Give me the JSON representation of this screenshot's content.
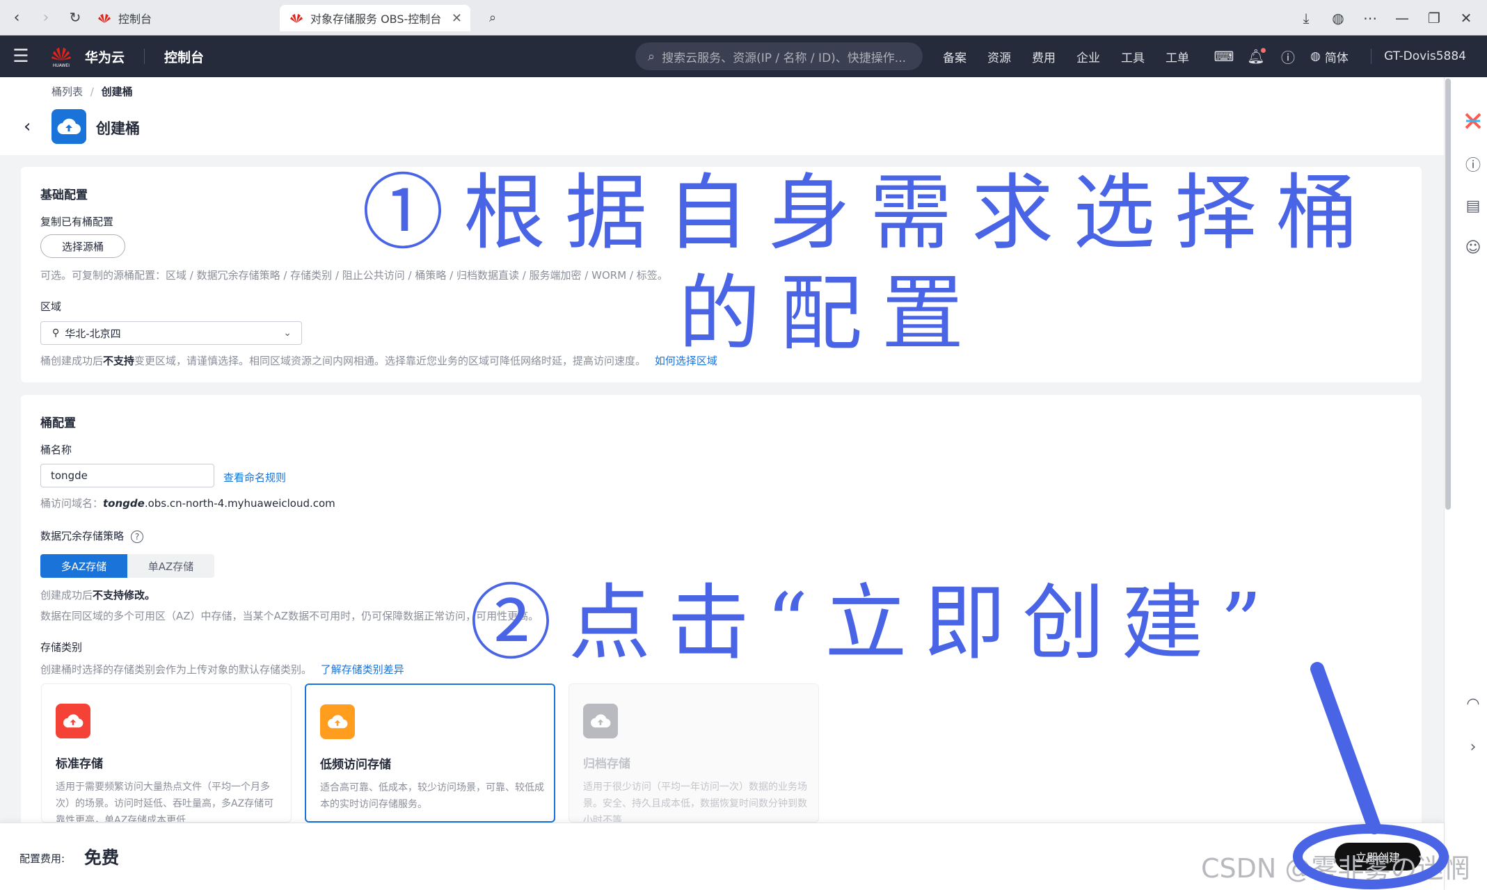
{
  "browser": {
    "tabs": [
      {
        "label": "控制台",
        "active": false
      },
      {
        "label": "对象存储服务 OBS-控制台",
        "active": true
      }
    ]
  },
  "header": {
    "brand": "华为云",
    "logo_text": "HUAWEI",
    "console": "控制台",
    "search_placeholder": "搜索云服务、资源(IP / 名称 / ID)、快捷操作...",
    "nav": [
      "备案",
      "资源",
      "费用",
      "企业",
      "工具",
      "工单"
    ],
    "lang": "简体",
    "user": "GT-Dovis5884"
  },
  "page": {
    "breadcrumb_parent": "桶列表",
    "breadcrumb_sep": "/",
    "breadcrumb_current": "创建桶",
    "title": "创建桶"
  },
  "basic": {
    "section_title": "基础配置",
    "copy_label": "复制已有桶配置",
    "select_source_btn": "选择源桶",
    "copy_hint": "可选。可复制的源桶配置：区域 / 数据冗余存储策略 / 存储类别 / 阻止公共访问 / 桶策略 / 归档数据直读 / 服务端加密 / WORM / 标签。",
    "region_label": "区域",
    "region_value": "华北-北京四",
    "region_hint_pre": "桶创建成功后",
    "region_hint_bold": "不支持",
    "region_hint_post": "变更区域，请谨慎选择。相同区域资源之间内网相通。选择靠近您业务的区域可降低网络时延，提高访问速度。",
    "region_link": "如何选择区域"
  },
  "bucket": {
    "section_title": "桶配置",
    "name_label": "桶名称",
    "name_value": "tongde",
    "naming_rule_link": "查看命名规则",
    "domain_label": "桶访问域名：",
    "domain_bucket": "tongde",
    "domain_suffix": ".obs.cn-north-4.myhuaweicloud.com",
    "redundancy_label": "数据冗余存储策略",
    "redundancy_options": [
      "多AZ存储",
      "单AZ存储"
    ],
    "redundancy_hint_pre": "创建成功后",
    "redundancy_hint_bold": "不支持修改。",
    "redundancy_desc": "数据在同区域的多个可用区（AZ）中存储，当某个AZ数据不可用时，仍可保障数据正常访问，可用性更高。",
    "storage_class_label": "存储类别",
    "storage_class_hint": "创建桶时选择的存储类别会作为上传对象的默认存储类别。",
    "storage_class_link": "了解存储类别差异",
    "storage_classes": [
      {
        "title": "标准存储",
        "desc": "适用于需要频繁访问大量热点文件（平均一个月多次）的场景。访问时延低、吞吐量高，多AZ存储可靠性更高，单AZ存储成本更低",
        "color": "#f44336"
      },
      {
        "title": "低频访问存储",
        "desc": "适合高可靠、低成本，较少访问场景，可靠、较低成本的实时访问存储服务。",
        "color": "#ff9d1f"
      },
      {
        "title": "归档存储",
        "desc": "适用于很少访问（平均一年访问一次）数据的业务场景。安全、持久且成本低，数据恢复时间数分钟到数小时不等",
        "color": "#b8babf"
      }
    ]
  },
  "footer": {
    "fee_label": "配置费用:",
    "fee_value": "免费",
    "create_btn": "立即创建"
  },
  "annotations": {
    "step1_line1": "①根据自身需求选择桶",
    "step1_line2": "的配置",
    "step2": "②点击“立即创建”"
  },
  "watermark": "CSDN @雾非雾の迷惘"
}
